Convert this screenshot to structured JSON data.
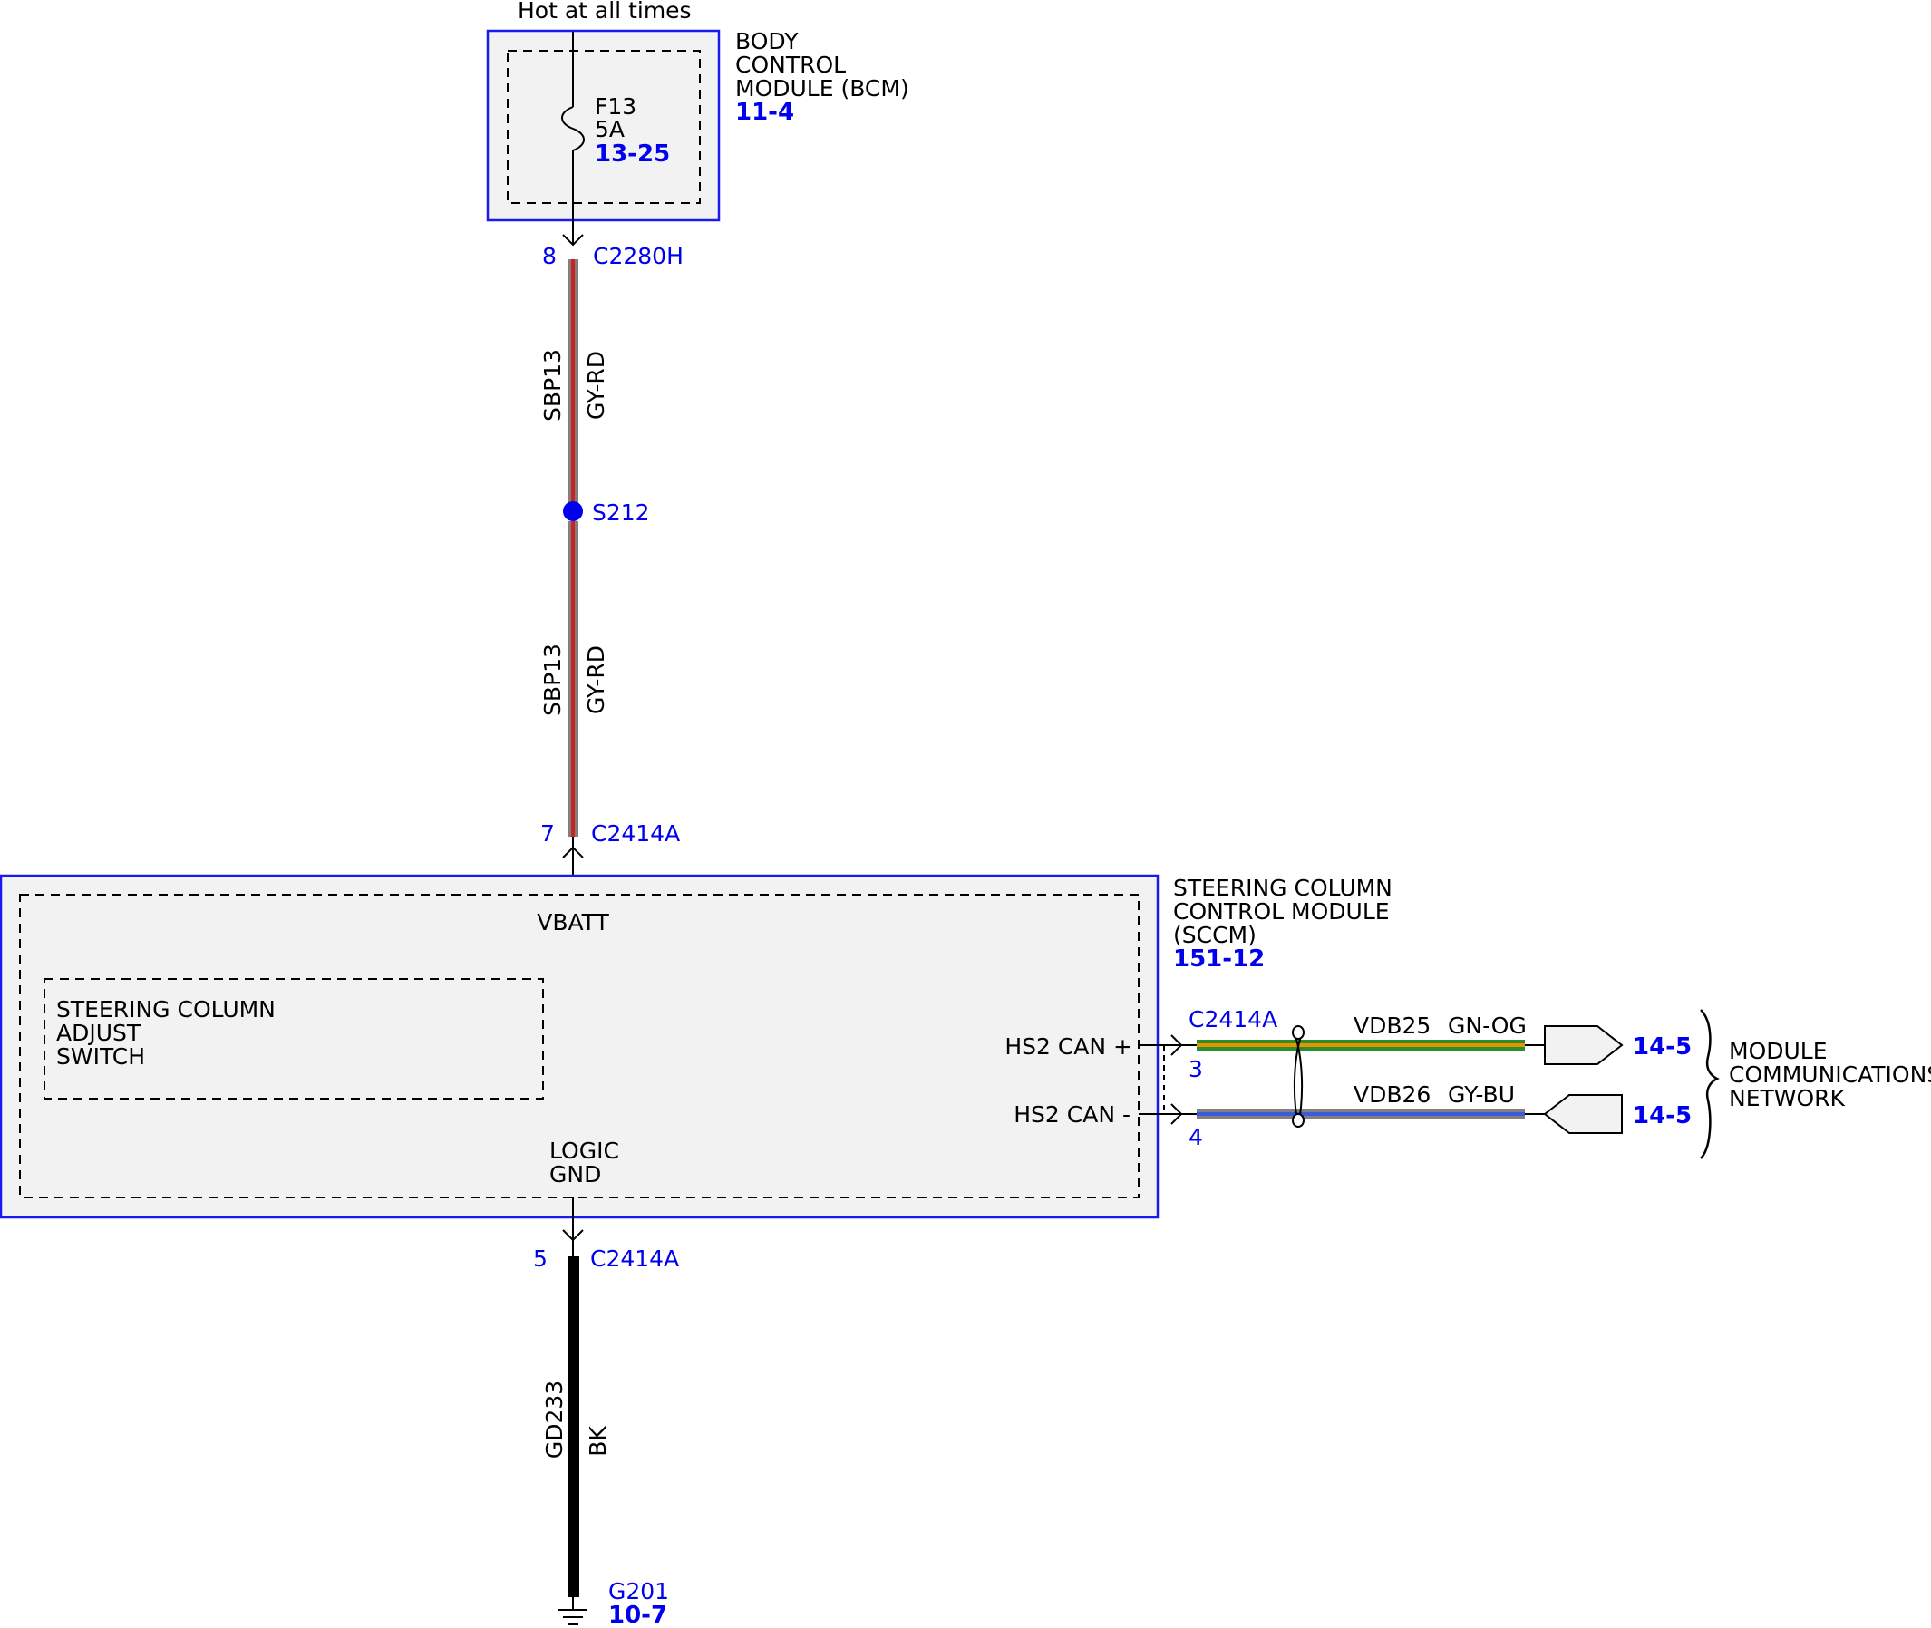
{
  "title": "Hot at all times",
  "bcm": {
    "lines": [
      "BODY",
      "CONTROL",
      "MODULE (BCM)"
    ],
    "ref": "11-4",
    "fuse": {
      "name": "F13",
      "rating": "5A",
      "ref": "13-25"
    }
  },
  "connectors": {
    "top": {
      "pin": "8",
      "name": "C2280H"
    },
    "sccm_in": {
      "pin": "7",
      "name": "C2414A"
    },
    "gnd": {
      "pin": "5",
      "name": "C2414A"
    },
    "can": {
      "name": "C2414A",
      "pin_plus": "3",
      "pin_minus": "4"
    }
  },
  "splice": {
    "name": "S212"
  },
  "wires": {
    "upper": {
      "circuit": "SBP13",
      "color": "GY-RD"
    },
    "lower": {
      "circuit": "SBP13",
      "color": "GY-RD"
    },
    "ground": {
      "circuit": "GD233",
      "color": "BK"
    },
    "can_high": {
      "circuit": "VDB25",
      "color": "GN-OG"
    },
    "can_low": {
      "circuit": "VDB26",
      "color": "GY-BU"
    }
  },
  "sccm": {
    "lines": [
      "STEERING COLUMN",
      "CONTROL MODULE",
      "(SCCM)"
    ],
    "ref": "151-12",
    "vbatt": "VBATT",
    "logic_gnd": [
      "LOGIC",
      "GND"
    ],
    "hs2_plus": "HS2 CAN +",
    "hs2_minus": "HS2 CAN -",
    "switch": [
      "STEERING COLUMN",
      "ADJUST",
      "SWITCH"
    ]
  },
  "network": {
    "ref_top": "14-5",
    "ref_bottom": "14-5",
    "lines": [
      "MODULE",
      "COMMUNICATIONS",
      "NETWORK"
    ]
  },
  "ground": {
    "name": "G201",
    "ref": "10-7"
  },
  "colors": {
    "module_border": "#1a1aee",
    "gray": "#808080",
    "red": "#cc2222",
    "green": "#2e8b2e",
    "orange": "#e69500",
    "blue": "#3b5bdb",
    "black": "#000000"
  }
}
